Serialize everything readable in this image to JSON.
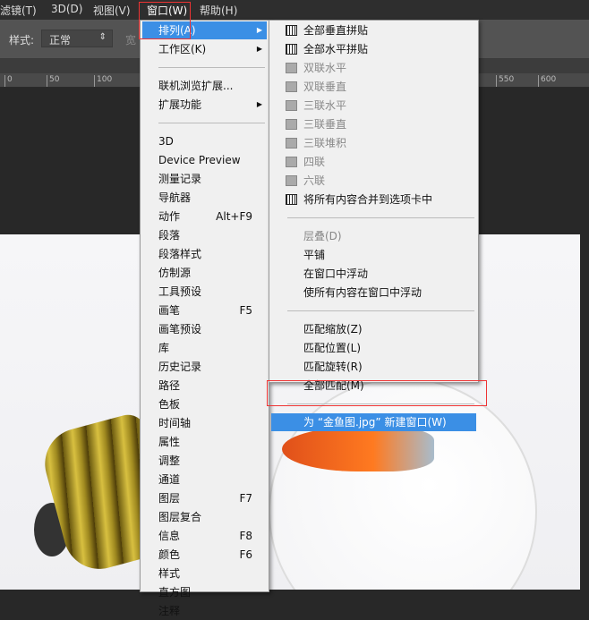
{
  "menubar": [
    "滤镜(T)",
    "3D(D)",
    "视图(V)",
    "窗口(W)",
    "帮助(H)"
  ],
  "options": {
    "style_label": "样式:",
    "style_value": "正常",
    "width_label": "宽"
  },
  "ruler": [
    "0",
    "50",
    "100",
    "550",
    "600"
  ],
  "window_menu": {
    "items": [
      {
        "label": "排列(A)",
        "submenu": true,
        "highlight": true
      },
      {
        "label": "工作区(K)",
        "submenu": true
      },
      {
        "sep": true
      },
      {
        "label": "联机浏览扩展..."
      },
      {
        "label": "扩展功能",
        "submenu": true
      },
      {
        "sep": true
      },
      {
        "label": "3D"
      },
      {
        "label": "Device Preview"
      },
      {
        "label": "测量记录"
      },
      {
        "label": "导航器"
      },
      {
        "label": "动作",
        "shortcut": "Alt+F9"
      },
      {
        "label": "段落"
      },
      {
        "label": "段落样式"
      },
      {
        "label": "仿制源"
      },
      {
        "label": "工具预设"
      },
      {
        "label": "画笔",
        "shortcut": "F5"
      },
      {
        "label": "画笔预设"
      },
      {
        "label": "库"
      },
      {
        "label": "历史记录"
      },
      {
        "label": "路径"
      },
      {
        "label": "色板"
      },
      {
        "label": "时间轴"
      },
      {
        "label": "属性"
      },
      {
        "label": "调整"
      },
      {
        "label": "通道"
      },
      {
        "label": "图层",
        "shortcut": "F7"
      },
      {
        "label": "图层复合"
      },
      {
        "label": "信息",
        "shortcut": "F8"
      },
      {
        "label": "颜色",
        "shortcut": "F6"
      },
      {
        "label": "样式"
      },
      {
        "label": "直方图"
      },
      {
        "label": "注释"
      }
    ]
  },
  "arrange_submenu": {
    "items": [
      {
        "label": "全部垂直拼贴",
        "icon": "tile-vertical-icon"
      },
      {
        "label": "全部水平拼贴",
        "icon": "tile-horizontal-icon"
      },
      {
        "label": "双联水平",
        "icon": "two-up-horizontal-icon",
        "disabled": true
      },
      {
        "label": "双联垂直",
        "icon": "two-up-vertical-icon",
        "disabled": true
      },
      {
        "label": "三联水平",
        "icon": "three-up-horizontal-icon",
        "disabled": true
      },
      {
        "label": "三联垂直",
        "icon": "three-up-vertical-icon",
        "disabled": true
      },
      {
        "label": "三联堆积",
        "icon": "three-up-stacked-icon",
        "disabled": true
      },
      {
        "label": "四联",
        "icon": "four-up-icon",
        "disabled": true
      },
      {
        "label": "六联",
        "icon": "six-up-icon",
        "disabled": true
      },
      {
        "label": "将所有内容合并到选项卡中",
        "icon": "consolidate-tabs-icon"
      },
      {
        "sep": true
      },
      {
        "label": "层叠(D)",
        "disabled": true
      },
      {
        "label": "平铺"
      },
      {
        "label": "在窗口中浮动"
      },
      {
        "label": "使所有内容在窗口中浮动"
      },
      {
        "sep": true
      },
      {
        "label": "匹配缩放(Z)"
      },
      {
        "label": "匹配位置(L)"
      },
      {
        "label": "匹配旋转(R)"
      },
      {
        "label": "全部匹配(M)"
      },
      {
        "sep": true
      },
      {
        "label": "为 “金鱼图.jpg” 新建窗口(W)",
        "highlight": true
      }
    ]
  }
}
